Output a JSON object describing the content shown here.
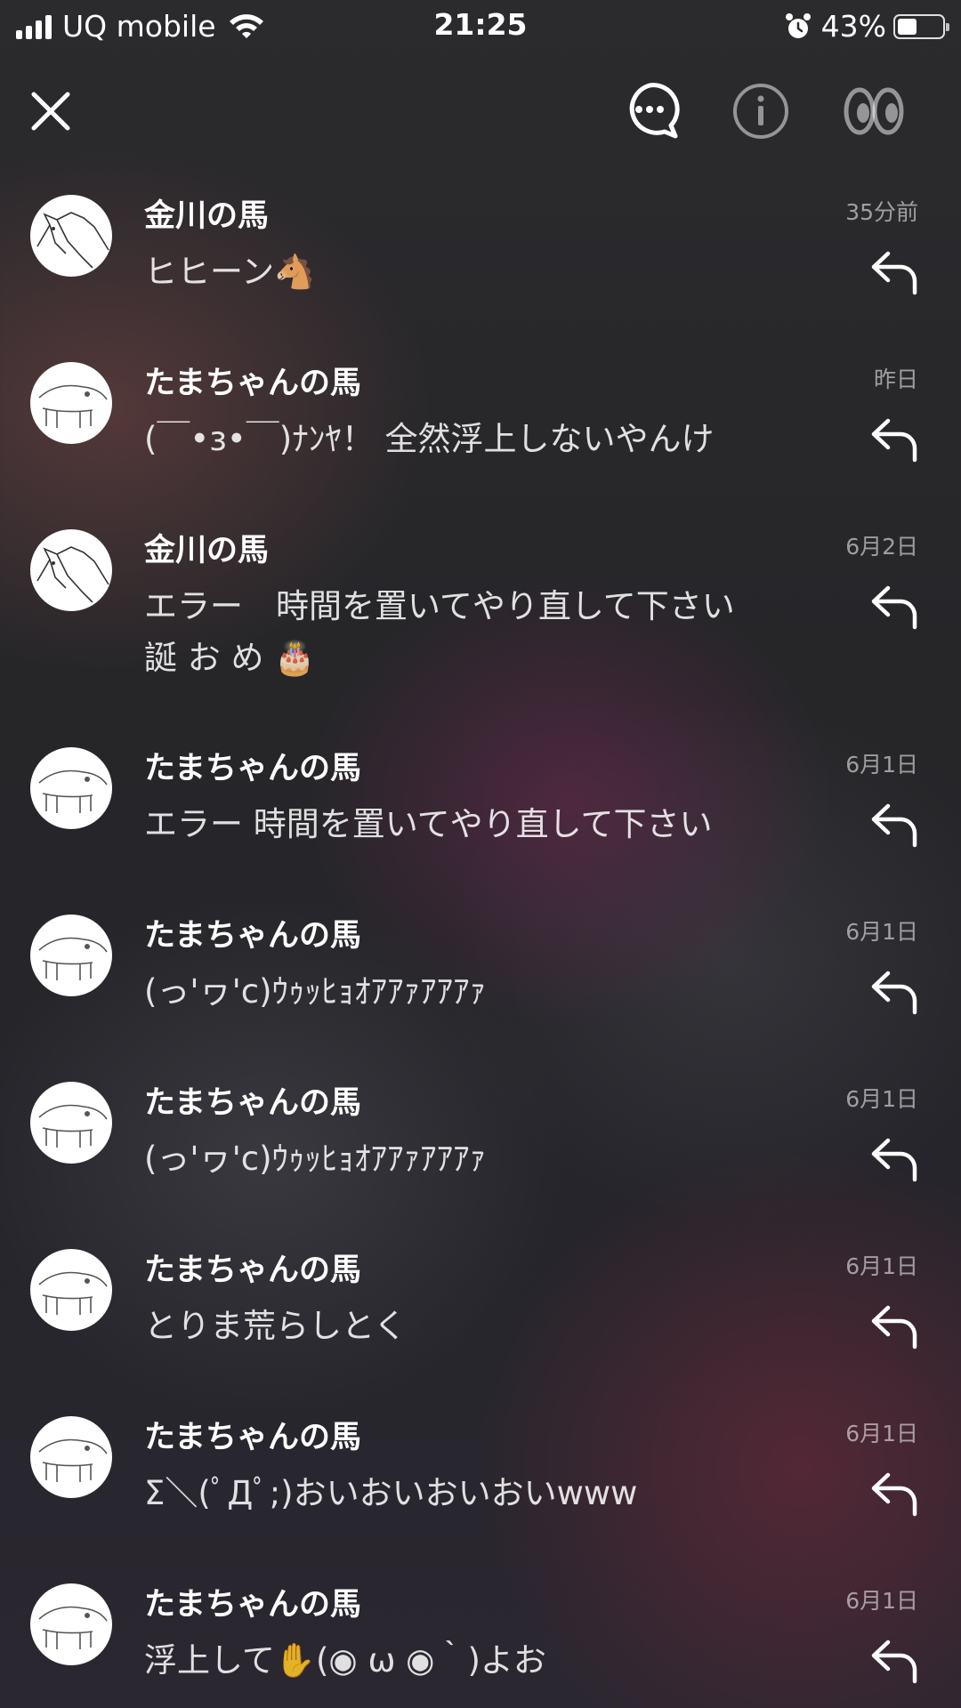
{
  "status_bar": {
    "carrier": "UQ mobile",
    "time": "21:25",
    "battery_percent": "43%",
    "battery_level": 0.43,
    "icons": [
      "signal-icon",
      "wifi-icon",
      "alarm-icon",
      "battery-icon"
    ]
  },
  "toolbar": {
    "icons": [
      "close-icon",
      "chat-bubble-icon",
      "info-icon",
      "eyes-icon"
    ]
  },
  "comments": [
    {
      "name": "金川の馬",
      "time": "35分前",
      "text": "ヒヒーン🐴",
      "avatar": "horse-head"
    },
    {
      "name": "たまちゃんの馬",
      "time": "昨日",
      "text": "(￣•з•￣)ﾅﾝﾔ！ 全然浮上しないやんけ",
      "avatar": "horse-body"
    },
    {
      "name": "金川の馬",
      "time": "6月2日",
      "text": "エラー　時間を置いてやり直して下さい\n誕 お め 🎂",
      "avatar": "horse-head"
    },
    {
      "name": "たまちゃんの馬",
      "time": "6月1日",
      "text": "エラー 時間を置いてやり直して下さい",
      "avatar": "horse-body"
    },
    {
      "name": "たまちゃんの馬",
      "time": "6月1日",
      "text": "(っ'ヮ'c)ｳｩｯﾋｮｵｱｱｧｱｱｱｧ",
      "avatar": "horse-body"
    },
    {
      "name": "たまちゃんの馬",
      "time": "6月1日",
      "text": "(っ'ヮ'c)ｳｩｯﾋｮｵｱｱｧｱｱｱｧ",
      "avatar": "horse-body"
    },
    {
      "name": "たまちゃんの馬",
      "time": "6月1日",
      "text": "とりま荒らしとく",
      "avatar": "horse-body"
    },
    {
      "name": "たまちゃんの馬",
      "time": "6月1日",
      "text": "Σ＼(ﾟДﾟ;)おいおいおいおいwww",
      "avatar": "horse-body"
    },
    {
      "name": "たまちゃんの馬",
      "time": "6月1日",
      "text": "浮上して✋(◉ ω ◉｀)よお",
      "avatar": "horse-body"
    }
  ]
}
